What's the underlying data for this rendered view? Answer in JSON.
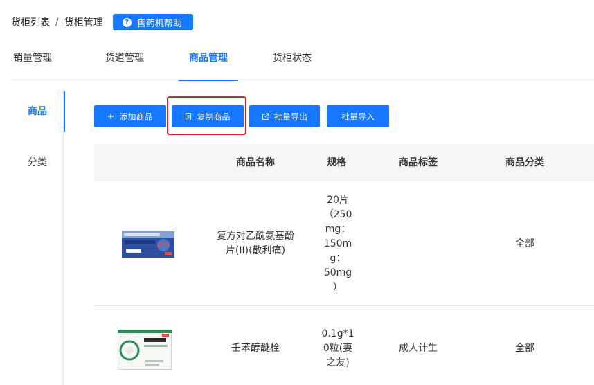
{
  "breadcrumb": {
    "parent": "货柜列表",
    "separator": "/",
    "current": "货柜管理"
  },
  "help_button": {
    "icon": "question-icon",
    "label": "售药机帮助"
  },
  "tabs": [
    {
      "label": "销量管理",
      "active": false
    },
    {
      "label": "货道管理",
      "active": false
    },
    {
      "label": "商品管理",
      "active": true
    },
    {
      "label": "货柜状态",
      "active": false
    }
  ],
  "sidebar": [
    {
      "label": "商品",
      "active": true
    },
    {
      "label": "分类",
      "active": false
    }
  ],
  "toolbar": {
    "add": {
      "icon": "plus-icon",
      "label": "添加商品"
    },
    "copy": {
      "icon": "copy-icon",
      "label": "复制商品",
      "highlighted": true
    },
    "export": {
      "icon": "export-icon",
      "label": "批量导出"
    },
    "import": {
      "label": "批量导入"
    }
  },
  "table": {
    "columns": [
      "商品名称",
      "规格",
      "商品标签",
      "商品分类"
    ],
    "rows": [
      {
        "image": "medicine-box-blue",
        "name_lines": [
          "复方对乙酰氨基酚",
          "片(II)(散利痛)"
        ],
        "spec_lines": [
          "20片",
          "（250",
          "mg：",
          "150m",
          "g：",
          "50mg",
          "）"
        ],
        "tag": "",
        "category": "全部"
      },
      {
        "image": "medicine-box-green",
        "name_lines": [
          "壬苯醇醚栓"
        ],
        "spec_lines": [
          "0.1g*1",
          "0粒(妻",
          "之友)"
        ],
        "tag": "成人计生",
        "category": "全部"
      }
    ]
  },
  "colors": {
    "primary": "#1677ff",
    "highlight": "#e02020",
    "header_bg": "#f5f6f8"
  }
}
